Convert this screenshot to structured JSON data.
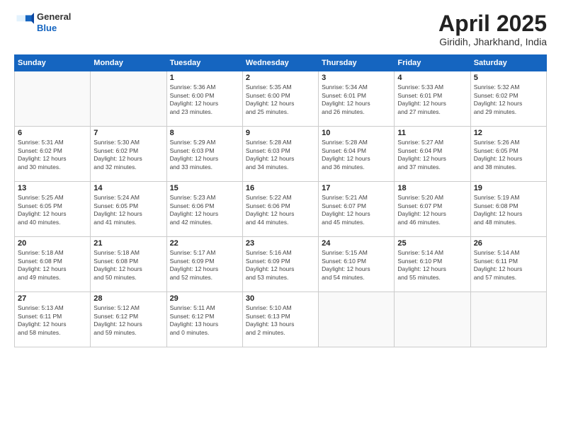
{
  "header": {
    "logo": {
      "general": "General",
      "blue": "Blue"
    },
    "title": "April 2025",
    "subtitle": "Giridih, Jharkhand, India"
  },
  "weekdays": [
    "Sunday",
    "Monday",
    "Tuesday",
    "Wednesday",
    "Thursday",
    "Friday",
    "Saturday"
  ],
  "weeks": [
    [
      {
        "day": "",
        "info": ""
      },
      {
        "day": "",
        "info": ""
      },
      {
        "day": "1",
        "info": "Sunrise: 5:36 AM\nSunset: 6:00 PM\nDaylight: 12 hours\nand 23 minutes."
      },
      {
        "day": "2",
        "info": "Sunrise: 5:35 AM\nSunset: 6:00 PM\nDaylight: 12 hours\nand 25 minutes."
      },
      {
        "day": "3",
        "info": "Sunrise: 5:34 AM\nSunset: 6:01 PM\nDaylight: 12 hours\nand 26 minutes."
      },
      {
        "day": "4",
        "info": "Sunrise: 5:33 AM\nSunset: 6:01 PM\nDaylight: 12 hours\nand 27 minutes."
      },
      {
        "day": "5",
        "info": "Sunrise: 5:32 AM\nSunset: 6:02 PM\nDaylight: 12 hours\nand 29 minutes."
      }
    ],
    [
      {
        "day": "6",
        "info": "Sunrise: 5:31 AM\nSunset: 6:02 PM\nDaylight: 12 hours\nand 30 minutes."
      },
      {
        "day": "7",
        "info": "Sunrise: 5:30 AM\nSunset: 6:02 PM\nDaylight: 12 hours\nand 32 minutes."
      },
      {
        "day": "8",
        "info": "Sunrise: 5:29 AM\nSunset: 6:03 PM\nDaylight: 12 hours\nand 33 minutes."
      },
      {
        "day": "9",
        "info": "Sunrise: 5:28 AM\nSunset: 6:03 PM\nDaylight: 12 hours\nand 34 minutes."
      },
      {
        "day": "10",
        "info": "Sunrise: 5:28 AM\nSunset: 6:04 PM\nDaylight: 12 hours\nand 36 minutes."
      },
      {
        "day": "11",
        "info": "Sunrise: 5:27 AM\nSunset: 6:04 PM\nDaylight: 12 hours\nand 37 minutes."
      },
      {
        "day": "12",
        "info": "Sunrise: 5:26 AM\nSunset: 6:05 PM\nDaylight: 12 hours\nand 38 minutes."
      }
    ],
    [
      {
        "day": "13",
        "info": "Sunrise: 5:25 AM\nSunset: 6:05 PM\nDaylight: 12 hours\nand 40 minutes."
      },
      {
        "day": "14",
        "info": "Sunrise: 5:24 AM\nSunset: 6:05 PM\nDaylight: 12 hours\nand 41 minutes."
      },
      {
        "day": "15",
        "info": "Sunrise: 5:23 AM\nSunset: 6:06 PM\nDaylight: 12 hours\nand 42 minutes."
      },
      {
        "day": "16",
        "info": "Sunrise: 5:22 AM\nSunset: 6:06 PM\nDaylight: 12 hours\nand 44 minutes."
      },
      {
        "day": "17",
        "info": "Sunrise: 5:21 AM\nSunset: 6:07 PM\nDaylight: 12 hours\nand 45 minutes."
      },
      {
        "day": "18",
        "info": "Sunrise: 5:20 AM\nSunset: 6:07 PM\nDaylight: 12 hours\nand 46 minutes."
      },
      {
        "day": "19",
        "info": "Sunrise: 5:19 AM\nSunset: 6:08 PM\nDaylight: 12 hours\nand 48 minutes."
      }
    ],
    [
      {
        "day": "20",
        "info": "Sunrise: 5:18 AM\nSunset: 6:08 PM\nDaylight: 12 hours\nand 49 minutes."
      },
      {
        "day": "21",
        "info": "Sunrise: 5:18 AM\nSunset: 6:08 PM\nDaylight: 12 hours\nand 50 minutes."
      },
      {
        "day": "22",
        "info": "Sunrise: 5:17 AM\nSunset: 6:09 PM\nDaylight: 12 hours\nand 52 minutes."
      },
      {
        "day": "23",
        "info": "Sunrise: 5:16 AM\nSunset: 6:09 PM\nDaylight: 12 hours\nand 53 minutes."
      },
      {
        "day": "24",
        "info": "Sunrise: 5:15 AM\nSunset: 6:10 PM\nDaylight: 12 hours\nand 54 minutes."
      },
      {
        "day": "25",
        "info": "Sunrise: 5:14 AM\nSunset: 6:10 PM\nDaylight: 12 hours\nand 55 minutes."
      },
      {
        "day": "26",
        "info": "Sunrise: 5:14 AM\nSunset: 6:11 PM\nDaylight: 12 hours\nand 57 minutes."
      }
    ],
    [
      {
        "day": "27",
        "info": "Sunrise: 5:13 AM\nSunset: 6:11 PM\nDaylight: 12 hours\nand 58 minutes."
      },
      {
        "day": "28",
        "info": "Sunrise: 5:12 AM\nSunset: 6:12 PM\nDaylight: 12 hours\nand 59 minutes."
      },
      {
        "day": "29",
        "info": "Sunrise: 5:11 AM\nSunset: 6:12 PM\nDaylight: 13 hours\nand 0 minutes."
      },
      {
        "day": "30",
        "info": "Sunrise: 5:10 AM\nSunset: 6:13 PM\nDaylight: 13 hours\nand 2 minutes."
      },
      {
        "day": "",
        "info": ""
      },
      {
        "day": "",
        "info": ""
      },
      {
        "day": "",
        "info": ""
      }
    ]
  ]
}
